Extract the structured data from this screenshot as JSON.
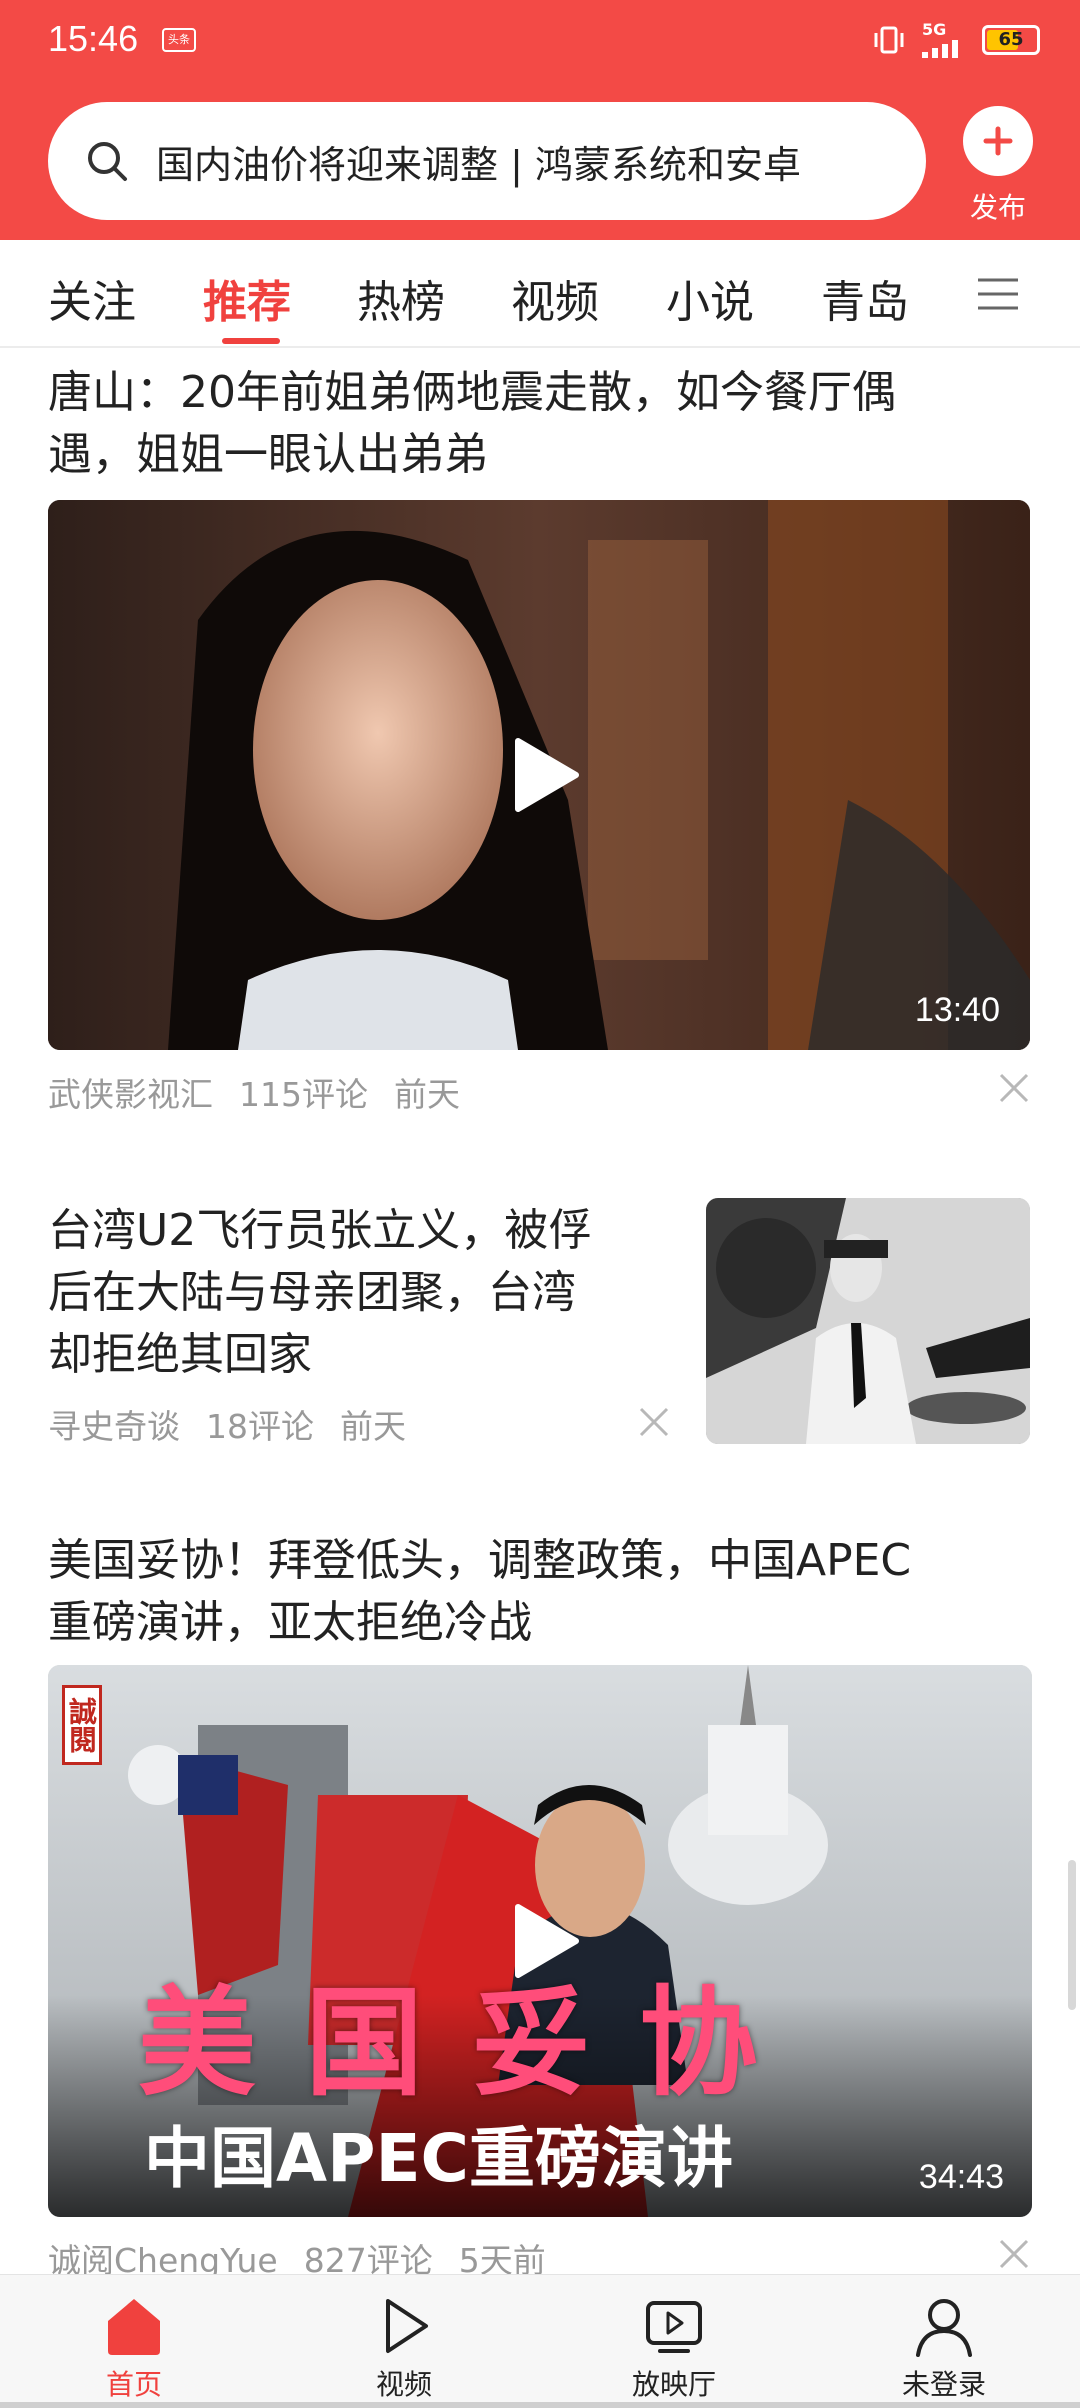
{
  "status_bar": {
    "time": "15:46",
    "app_badge": "头条",
    "network": "5G",
    "battery": "65",
    "battery_level": 0.65
  },
  "search": {
    "text": "国内油价将迎来调整 | 鸿蒙系统和安卓"
  },
  "publish": {
    "label": "发布"
  },
  "tabs": [
    {
      "label": "关注"
    },
    {
      "label": "推荐",
      "active": true
    },
    {
      "label": "热榜"
    },
    {
      "label": "视频"
    },
    {
      "label": "小说"
    },
    {
      "label": "青岛"
    }
  ],
  "feed": [
    {
      "title_line1": "唐山：20年前姐弟俩地震走散，如今餐厅偶",
      "title_line2": "遇，姐姐一眼认出弟弟",
      "duration": "13:40",
      "source": "武侠影视汇",
      "comments": "115评论",
      "time": "前天"
    },
    {
      "title_line1": "台湾U2飞行员张立义，被俘",
      "title_line2": "后在大陆与母亲团聚，台湾",
      "title_line3": "却拒绝其回家",
      "source": "寻史奇谈",
      "comments": "18评论",
      "time": "前天"
    },
    {
      "title_line1": "美国妥协！拜登低头，调整政策，中国APEC",
      "title_line2": "重磅演讲，亚太拒绝冷战",
      "overlay_big": "美 国 妥 协",
      "overlay_sub": "中国APEC重磅演讲",
      "seal": "誠閱",
      "duration": "34:43",
      "source": "诚阅ChengYue",
      "comments": "827评论",
      "time": "5天前"
    }
  ],
  "bottom_nav": [
    {
      "label": "首页",
      "icon": "home-icon",
      "active": true
    },
    {
      "label": "视频",
      "icon": "play-icon"
    },
    {
      "label": "放映厅",
      "icon": "cinema-icon"
    },
    {
      "label": "未登录",
      "icon": "user-icon"
    }
  ],
  "colors": {
    "brand_red": "#f34a46",
    "active_tab": "#f0413e",
    "meta_gray": "#999999"
  }
}
